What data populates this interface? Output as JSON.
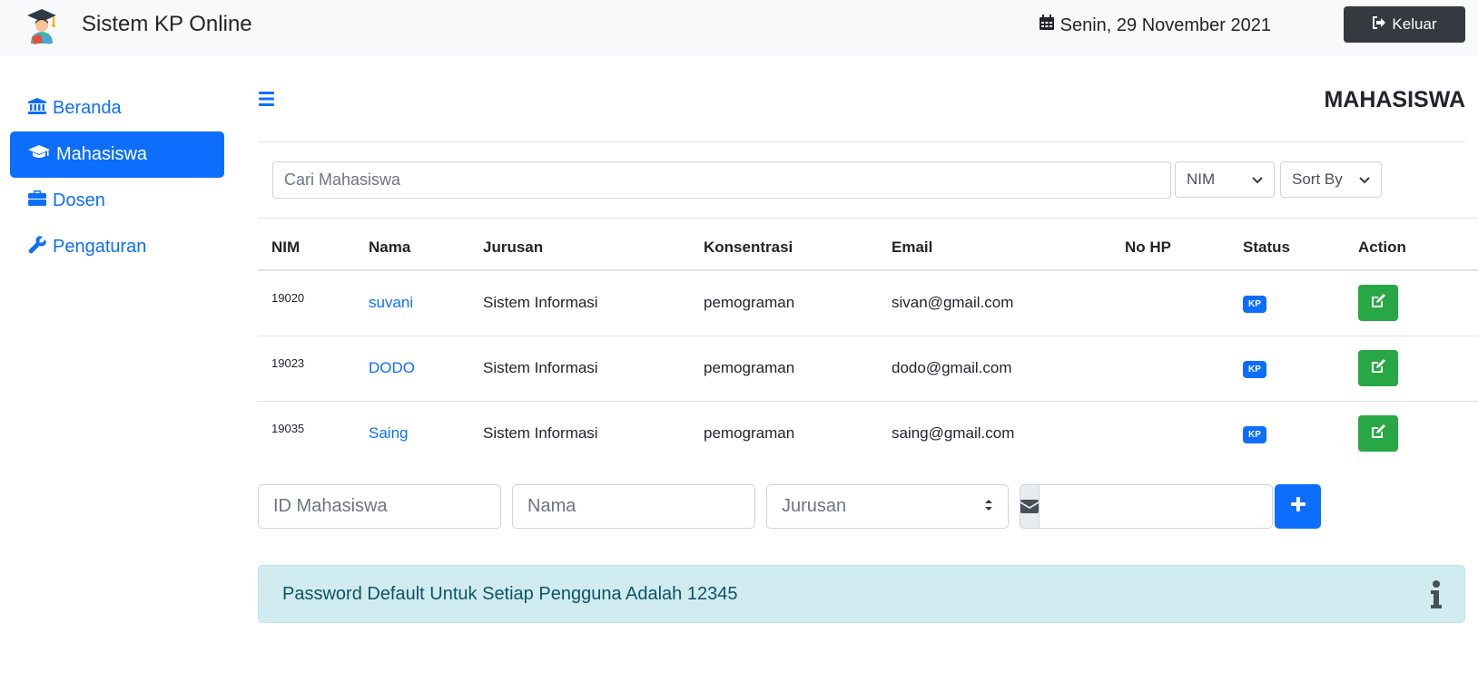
{
  "header": {
    "app_title": "Sistem KP Online",
    "date_text": "Senin, 29 November 2021",
    "logout_label": "Keluar"
  },
  "sidebar": {
    "items": [
      {
        "label": "Beranda",
        "icon": "bank-icon",
        "active": false
      },
      {
        "label": "Mahasiswa",
        "icon": "graduation-cap-icon",
        "active": true
      },
      {
        "label": "Dosen",
        "icon": "briefcase-icon",
        "active": false
      },
      {
        "label": "Pengaturan",
        "icon": "wrench-icon",
        "active": false
      }
    ]
  },
  "main": {
    "page_title": "MAHASISWA",
    "search_placeholder": "Cari Mahasiswa",
    "filter_field": "NIM",
    "sort_label": "Sort By",
    "table": {
      "headers": [
        "NIM",
        "Nama",
        "Jurusan",
        "Konsentrasi",
        "Email",
        "No HP",
        "Status",
        "Action"
      ],
      "rows": [
        {
          "nim": "19020",
          "nama": "suvani",
          "jurusan": "Sistem Informasi",
          "konsentrasi": "pemograman",
          "email": "sivan@gmail.com",
          "no_hp": "",
          "status": "KP"
        },
        {
          "nim": "19023",
          "nama": "DODO",
          "jurusan": "Sistem Informasi",
          "konsentrasi": "pemograman",
          "email": "dodo@gmail.com",
          "no_hp": "",
          "status": "KP"
        },
        {
          "nim": "19035",
          "nama": "Saing",
          "jurusan": "Sistem Informasi",
          "konsentrasi": "pemograman",
          "email": "saing@gmail.com",
          "no_hp": "",
          "status": "KP"
        }
      ]
    },
    "form": {
      "id_placeholder": "ID Mahasiswa",
      "nama_placeholder": "Nama",
      "jurusan_label": "Jurusan",
      "email_value": ""
    },
    "alert_text": "Password Default Untuk Setiap Pengguna Adalah 12345"
  },
  "colors": {
    "primary": "#0d6efd",
    "success": "#28a745",
    "dark": "#343a40",
    "info_bg": "#d1ecf1",
    "info_text": "#0c5460"
  }
}
